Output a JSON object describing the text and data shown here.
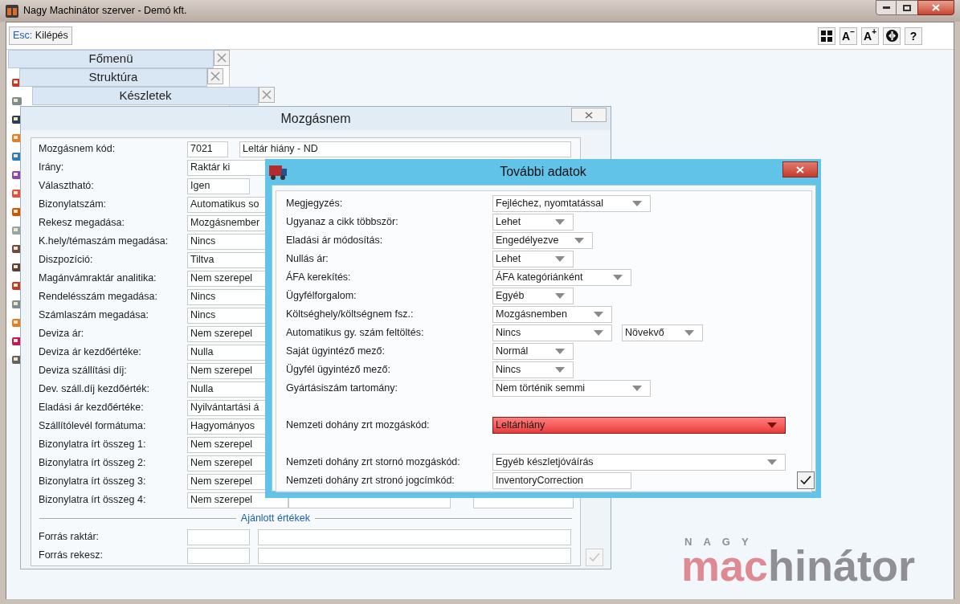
{
  "window": {
    "title": "Nagy Machinátor szerver - Demó kft."
  },
  "toolbar": {
    "exit_key": "Esc:",
    "exit_label": "Kilépés",
    "buttons": [
      {
        "kind": "grid"
      },
      {
        "kind": "text",
        "label": "A",
        "mark": "−"
      },
      {
        "kind": "text",
        "label": "A",
        "mark": "+"
      },
      {
        "kind": "circle"
      },
      {
        "kind": "text",
        "label": "?"
      }
    ]
  },
  "tabs": [
    {
      "label": "Főmenü"
    },
    {
      "label": "Struktúra"
    },
    {
      "label": "Készletek"
    }
  ],
  "mozgasnem": {
    "title": "Mozgásnem",
    "code_label": "Mozgásnem kód:",
    "code": "7021",
    "name": "Leltár hiány - ND",
    "fields": [
      {
        "label": "Irány:",
        "value": "Raktár ki",
        "kind": "wide"
      },
      {
        "label": "Választható:",
        "value": "Igen",
        "kind": "short"
      },
      {
        "label": "Bizonylatszám:",
        "value": "Automatikus so",
        "kind": "wide"
      },
      {
        "label": "Rekesz megadása:",
        "value": "Mozgásnember",
        "kind": "wide"
      },
      {
        "label": "K.hely/témaszám megadása:",
        "value": "Nincs",
        "kind": "wide"
      },
      {
        "label": "Diszpozíció:",
        "value": "Tiltva",
        "kind": "wide"
      },
      {
        "label": "Magánvámraktár analitika:",
        "value": "Nem szerepel",
        "kind": "wide"
      },
      {
        "label": "Rendelésszám megadása:",
        "value": "Nincs",
        "kind": "wide"
      },
      {
        "label": "Számlaszám megadása:",
        "value": "Nincs",
        "kind": "wide"
      },
      {
        "label": "Deviza ár:",
        "value": "Nem szerepel",
        "kind": "wide"
      },
      {
        "label": "Deviza ár kezdőértéke:",
        "value": "Nulla",
        "kind": "wide"
      },
      {
        "label": "Deviza szállítási díj:",
        "value": "Nem szerepel",
        "kind": "wide"
      },
      {
        "label": "Dev. száll.díj kezdőérték:",
        "value": "Nulla",
        "kind": "wide"
      },
      {
        "label": "Eladási ár kezdőértéke:",
        "value": "Nyilvántartási á",
        "kind": "wide"
      },
      {
        "label": "Szállítólevél formátuma:",
        "value": "Hagyományos",
        "kind": "wide"
      },
      {
        "label": "Bizonylatra írt összeg 1:",
        "value": "Nem szerepel",
        "kind": "wide"
      },
      {
        "label": "Bizonylatra írt összeg 2:",
        "value": "Nem szerepel",
        "kind": "wide"
      },
      {
        "label": "Bizonylatra írt összeg 3:",
        "value": "Nem szerepel",
        "kind": "wide"
      },
      {
        "label": "Bizonylatra írt összeg 4:",
        "value": "Nem szerepel",
        "kind": "split"
      }
    ],
    "section": "Ajánlott értékek",
    "recommended": [
      {
        "label": "Forrás raktár:"
      },
      {
        "label": "Forrás rekesz:"
      }
    ],
    "confirm_enabled": false
  },
  "tovabbi": {
    "title": "További adatok",
    "sections": [
      [
        {
          "label": "Megjegyzés:",
          "value": "Fejléchez, nyomtatással",
          "kind": "dropdown",
          "invalid": false
        },
        {
          "label": "Ugyanaz a cikk többször:",
          "value": "Lehet",
          "kind": "dropdown",
          "invalid": false
        },
        {
          "label": "Eladási ár módosítás:",
          "value": "Engedélyezve",
          "kind": "dropdown",
          "invalid": false
        },
        {
          "label": "Nullás ár:",
          "value": "Lehet",
          "kind": "dropdown",
          "invalid": false
        },
        {
          "label": "ÁFA kerekítés:",
          "value": "ÁFA kategóriánként",
          "kind": "dropdown",
          "invalid": false
        },
        {
          "label": "Ügyfélforgalom:",
          "value": "Egyéb",
          "kind": "dropdown",
          "invalid": false
        },
        {
          "label": "Költséghely/költségnem fsz.:",
          "value": "Mozgásnemben",
          "kind": "dropdown",
          "invalid": false
        },
        {
          "label": "Automatikus gy. szám feltöltés:",
          "value": "Nincs",
          "value2": "Növekvő",
          "kind": "dropdown",
          "invalid": false
        },
        {
          "label": "Saját ügyintéző mező:",
          "value": "Normál",
          "kind": "dropdown",
          "invalid": false
        },
        {
          "label": "Ügyfél ügyintéző mező:",
          "value": "Nincs",
          "kind": "dropdown",
          "invalid": false
        },
        {
          "label": "Gyártásiszám tartomány:",
          "value": "Nem történik semmi",
          "kind": "dropdown",
          "invalid": false
        }
      ],
      [
        {
          "label": "Nemzeti dohány zrt mozgáskód:",
          "value": "Leltárhiány",
          "kind": "dropdown",
          "invalid": true
        }
      ],
      [
        {
          "label": "Nemzeti dohány zrt stornó mozgáskód:",
          "value": "Egyéb készletjóváírás",
          "kind": "dropdown",
          "invalid": false
        },
        {
          "label": "Nemzeti dohány zrt stronó jogcímkód:",
          "value": "InventoryCorrection",
          "kind": "text",
          "invalid": false
        }
      ]
    ],
    "confirm_enabled": true
  },
  "logo": {
    "small": "NAGY",
    "accent": "mac",
    "rest": "hinátor"
  }
}
